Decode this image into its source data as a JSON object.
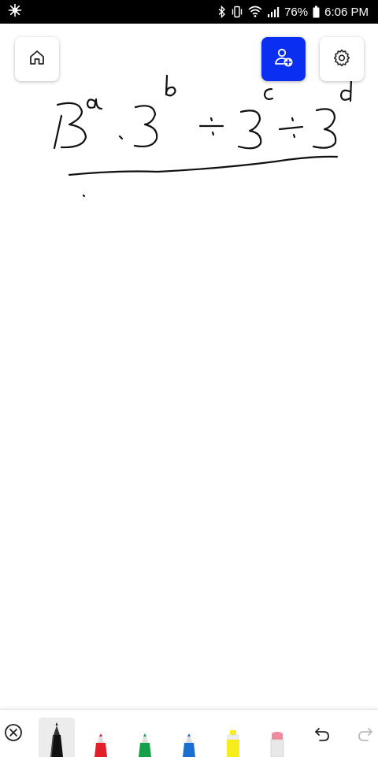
{
  "status_bar": {
    "battery": "76%",
    "time": "6:06 PM",
    "icons": [
      "app-notification-icon",
      "bluetooth-icon",
      "vibrate-icon",
      "wifi-icon",
      "signal-icon",
      "battery-icon"
    ]
  },
  "header": {
    "home_icon": "home-icon",
    "add_user_icon": "add-user-icon",
    "settings_icon": "gear-icon"
  },
  "toolbar": {
    "pens": [
      {
        "name": "black-marker",
        "color": "#111111"
      },
      {
        "name": "red-marker",
        "color": "#e3202a"
      },
      {
        "name": "green-marker",
        "color": "#16a04a"
      },
      {
        "name": "blue-marker",
        "color": "#1a6fd0"
      },
      {
        "name": "yellow-highlighter",
        "color": "#f7ec1c"
      },
      {
        "name": "eraser",
        "color": "#f08aa0"
      }
    ],
    "selected_pen": "black-marker",
    "icons": [
      "close-circle-icon",
      "undo-icon",
      "redo-icon"
    ]
  },
  "colors": {
    "accent": "#0a2ff0",
    "ink": "#111111"
  }
}
